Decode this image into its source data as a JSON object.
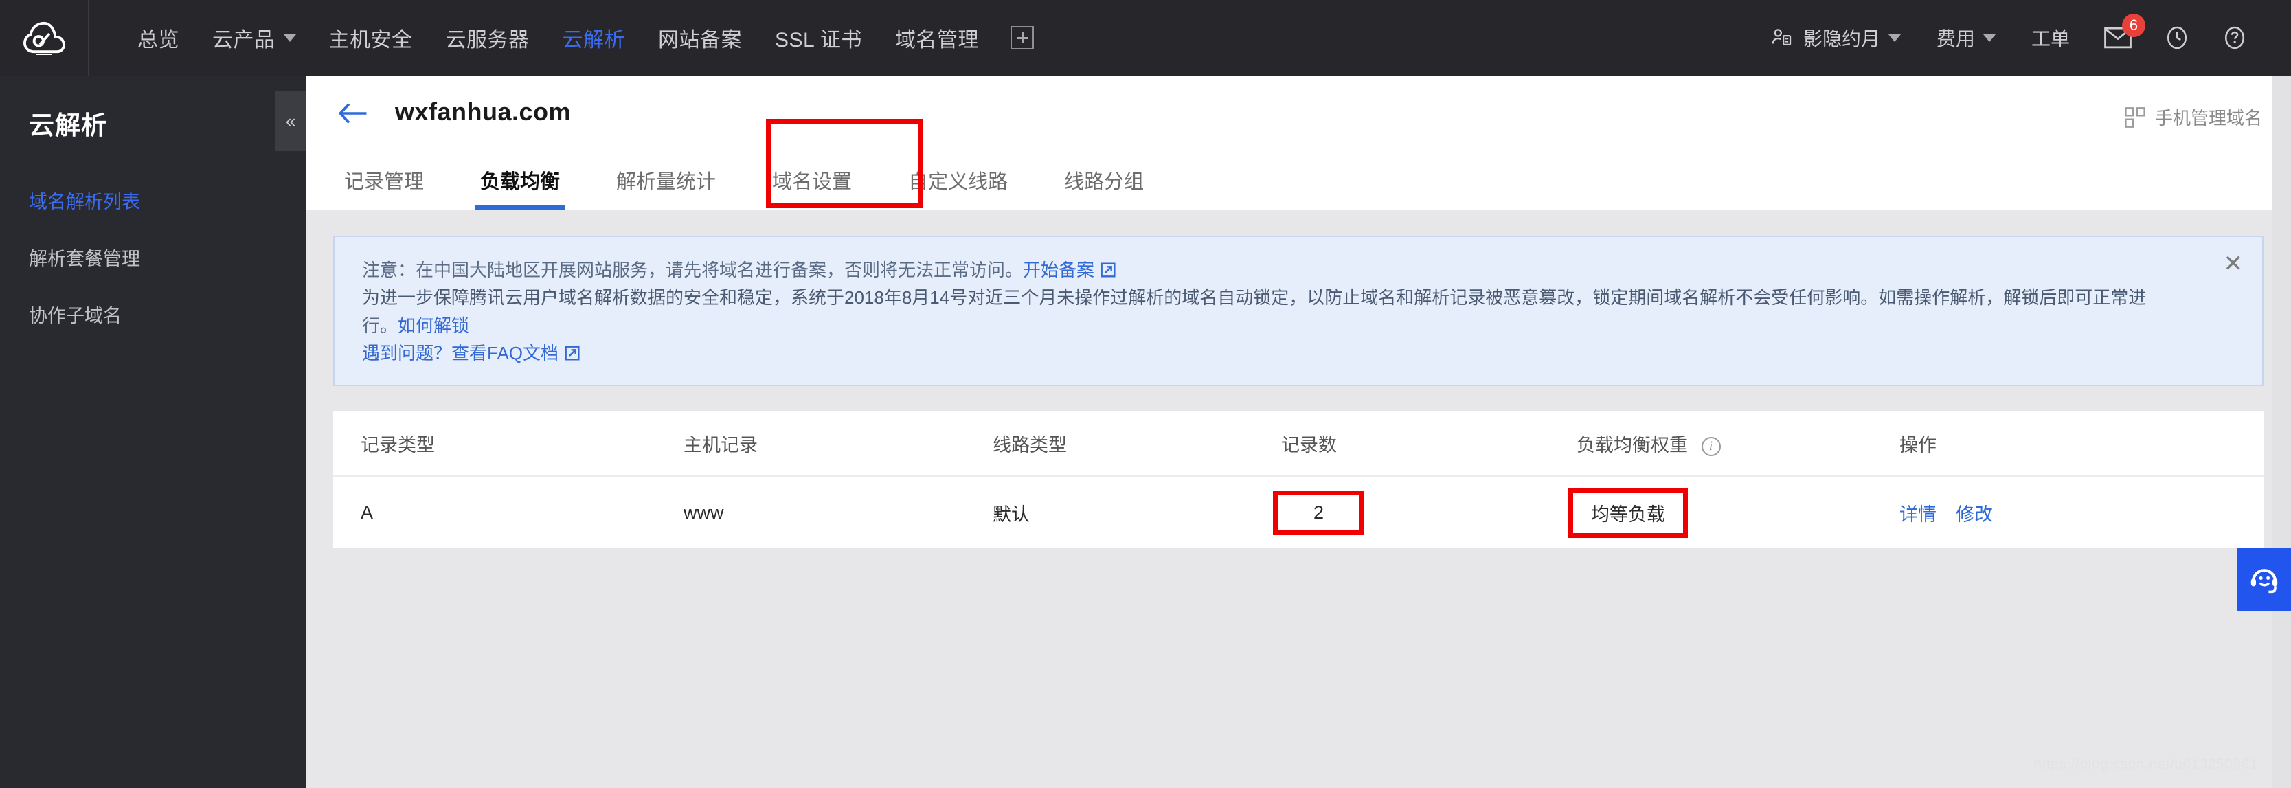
{
  "topbar": {
    "logo_name": "tencent-cloud-logo",
    "nav_items": [
      {
        "label": "总览",
        "active": false,
        "has_caret": false
      },
      {
        "label": "云产品",
        "active": false,
        "has_caret": true
      },
      {
        "label": "主机安全",
        "active": false,
        "has_caret": false
      },
      {
        "label": "云服务器",
        "active": false,
        "has_caret": false
      },
      {
        "label": "云解析",
        "active": true,
        "has_caret": false
      },
      {
        "label": "网站备案",
        "active": false,
        "has_caret": false
      },
      {
        "label": "SSL 证书",
        "active": false,
        "has_caret": false
      },
      {
        "label": "域名管理",
        "active": false,
        "has_caret": false
      }
    ],
    "add_icon": "plus-box-icon",
    "right": {
      "user_icon": "user-icon",
      "user_name": "影隐约月",
      "fee_label": "费用",
      "ticket_label": "工单",
      "mail_icon": "mail-icon",
      "mail_badge": "6",
      "history_icon": "clock-icon",
      "help_icon": "question-circle-icon"
    }
  },
  "sidebar": {
    "title": "云解析",
    "collapse_icon": "«",
    "items": [
      {
        "label": "域名解析列表",
        "active": true
      },
      {
        "label": "解析套餐管理",
        "active": false
      },
      {
        "label": "协作子域名",
        "active": false
      }
    ]
  },
  "page": {
    "back_icon": "back-arrow-icon",
    "title": "wxfanhua.com",
    "mobile_manage": "手机管理域名",
    "qr_icon": "qr-code-icon"
  },
  "tabs": [
    {
      "label": "记录管理",
      "active": false
    },
    {
      "label": "负载均衡",
      "active": true
    },
    {
      "label": "解析量统计",
      "active": false
    },
    {
      "label": "域名设置",
      "active": false
    },
    {
      "label": "自定义线路",
      "active": false
    },
    {
      "label": "线路分组",
      "active": false
    }
  ],
  "notice": {
    "line1_prefix": "注意：在中国大陆地区开展网站服务，请先将域名进行备案，否则将无法正常访问。",
    "line1_link": "开始备案",
    "line2": "为进一步保障腾讯云用户域名解析数据的安全和稳定，系统于2018年8月14号对近三个月未操作过解析的域名自动锁定，以防止域名和解析记录被恶意篡改，锁定期间域名解析不会受任何影响。如需操作解析，解锁后即可正常进",
    "line3_prefix": "行。",
    "line3_link": "如何解锁",
    "line4_prefix": "遇到问题？",
    "line4_link": "查看FAQ文档",
    "close_icon": "close-icon",
    "external_icon": "external-link-icon"
  },
  "table": {
    "columns": [
      {
        "label": "记录类型",
        "info": false
      },
      {
        "label": "主机记录",
        "info": false
      },
      {
        "label": "线路类型",
        "info": false
      },
      {
        "label": "记录数",
        "info": false
      },
      {
        "label": "负载均衡权重",
        "info": true
      },
      {
        "label": "操作",
        "info": false
      }
    ],
    "rows": [
      {
        "record_type": "A",
        "host_record": "www",
        "line_type": "默认",
        "record_count": "2",
        "weight": "均等负载",
        "actions": [
          "详情",
          "修改"
        ]
      }
    ]
  },
  "support": {
    "icon": "headset-smiley-icon"
  },
  "watermark": "https://blog.csdn.net/u013250861",
  "colors": {
    "topbar_bg": "#26262b",
    "sidebar_bg": "#292930",
    "accent_blue": "#2f6bd8",
    "highlight_red": "#f00000",
    "notice_bg": "#e7eefb",
    "support_blue": "#2255ee",
    "badge_red": "#e8413a"
  }
}
